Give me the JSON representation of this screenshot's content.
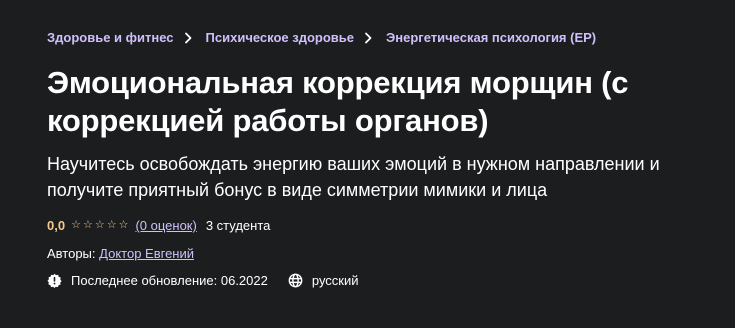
{
  "breadcrumbs": [
    {
      "label": "Здоровье и фитнес"
    },
    {
      "label": "Психическое здоровье"
    },
    {
      "label": "Энергетическая психология (EP)"
    }
  ],
  "title": "Эмоциональная коррекция морщин (с коррекцией работы органов)",
  "subtitle": "Научитесь освобождать энергию ваших эмоций в нужном направлении и получите приятный бонус в виде симметрии мимики и лица",
  "rating": {
    "value": "0,0",
    "stars_filled": 0,
    "stars_total": 5,
    "ratings_link": "(0 оценок)",
    "students": "3 студента"
  },
  "authors": {
    "label": "Авторы:",
    "name": "Доктор Евгений"
  },
  "meta": {
    "update_label": "Последнее обновление:",
    "update_date": "06.2022",
    "update_icon": "alert-badge-icon",
    "language": "русский",
    "language_icon": "globe-icon"
  },
  "colors": {
    "background": "#1c1d1f",
    "link": "#cec0fc",
    "rating": "#f3ca8c",
    "text": "#ffffff"
  }
}
